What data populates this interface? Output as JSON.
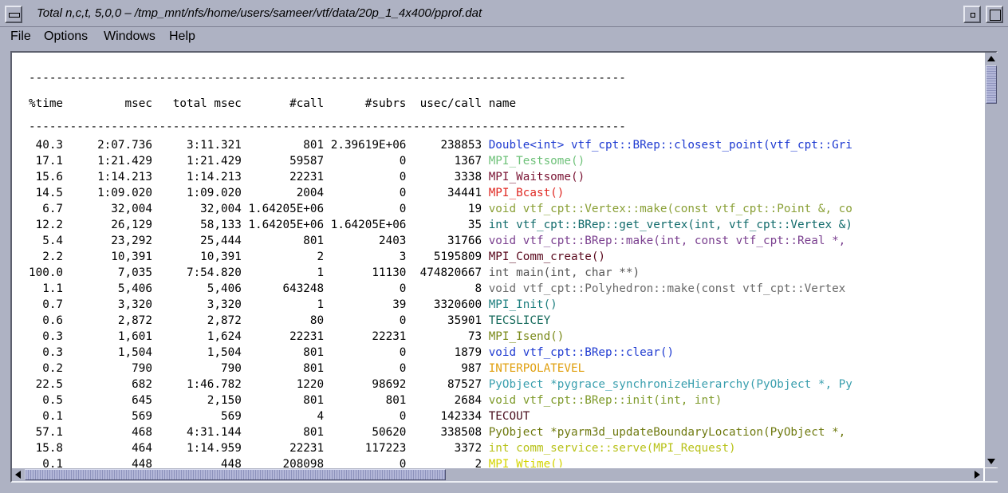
{
  "window": {
    "title": "Total n,c,t, 5,0,0 – /tmp_mnt/nfs/home/users/sameer/vtf/data/20p_1_4x400/pprof.dat"
  },
  "menubar": {
    "items": [
      "File",
      "Options",
      "Windows",
      "Help"
    ]
  },
  "profile": {
    "separator": "---------------------------------------------------------------------------------------",
    "header": "%time         msec   total msec       #call      #subrs  usec/call name",
    "rows": [
      {
        "text": " 40.3     2:07.736     3:11.321         801 2.39619E+06     238853 ",
        "name": "Double<int> vtf_cpt::BRep::closest_point(vtf_cpt::Gri",
        "color": "#1f3bd1"
      },
      {
        "text": " 17.1     1:21.429     1:21.429       59587           0       1367 ",
        "name": "MPI_Testsome()",
        "color": "#6fc27a"
      },
      {
        "text": " 15.6     1:14.213     1:14.213       22231           0       3338 ",
        "name": "MPI_Waitsome()",
        "color": "#7a1535"
      },
      {
        "text": " 14.5     1:09.020     1:09.020        2004           0      34441 ",
        "name": "MPI_Bcast()",
        "color": "#e02a24"
      },
      {
        "text": "  6.7       32,004       32,004 1.64205E+06           0         19 ",
        "name": "void vtf_cpt::Vertex::make(const vtf_cpt::Point &, co",
        "color": "#8aa037"
      },
      {
        "text": " 12.2       26,129       58,133 1.64205E+06 1.64205E+06         35 ",
        "name": "int vtf_cpt::BRep::get_vertex(int, vtf_cpt::Vertex &)",
        "color": "#0f6a6a"
      },
      {
        "text": "  5.4       23,292       25,444         801        2403      31766 ",
        "name": "void vtf_cpt::BRep::make(int, const vtf_cpt::Real *,",
        "color": "#7a3f8f"
      },
      {
        "text": "  2.2       10,391       10,391           2           3    5195809 ",
        "name": "MPI_Comm_create()",
        "color": "#5a0a1e"
      },
      {
        "text": "100.0        7,035     7:54.820           1       11130  474820667 ",
        "name": "int main(int, char **)",
        "color": "#555555"
      },
      {
        "text": "  1.1        5,406        5,406      643248           0          8 ",
        "name": "void vtf_cpt::Polyhedron::make(const vtf_cpt::Vertex",
        "color": "#6a6a6a"
      },
      {
        "text": "  0.7        3,320        3,320           1          39    3320600 ",
        "name": "MPI_Init()",
        "color": "#1e7f7f"
      },
      {
        "text": "  0.6        2,872        2,872          80           0      35901 ",
        "name": "TECSLICEY",
        "color": "#176b5c"
      },
      {
        "text": "  0.3        1,601        1,624       22231       22231         73 ",
        "name": "MPI_Isend()",
        "color": "#7a8a1a"
      },
      {
        "text": "  0.3        1,504        1,504         801           0       1879 ",
        "name": "void vtf_cpt::BRep::clear()",
        "color": "#1f3bd1"
      },
      {
        "text": "  0.2          790          790         801           0        987 ",
        "name": "INTERPOLATEVEL",
        "color": "#e0a010"
      },
      {
        "text": " 22.5          682     1:46.782        1220       98692      87527 ",
        "name": "PyObject *pygrace_synchronizeHierarchy(PyObject *, Py",
        "color": "#3a9fae"
      },
      {
        "text": "  0.5          645        2,150         801         801       2684 ",
        "name": "void vtf_cpt::BRep::init(int, int)",
        "color": "#7e9a2a"
      },
      {
        "text": "  0.1          569          569           4           0     142334 ",
        "name": "TECOUT",
        "color": "#4a0f1e"
      },
      {
        "text": " 57.1          468     4:31.144         801       50620     338508 ",
        "name": "PyObject *pyarm3d_updateBoundaryLocation(PyObject *,",
        "color": "#6f7a10"
      },
      {
        "text": " 15.8          464     1:14.959       22231      117223       3372 ",
        "name": "int comm_service::serve(MPI_Request)",
        "color": "#b8c21a"
      },
      {
        "text": "  0.1          448          448      208098           0          2 ",
        "name": "MPI_Wtime()",
        "color": "#d4d400"
      }
    ]
  }
}
